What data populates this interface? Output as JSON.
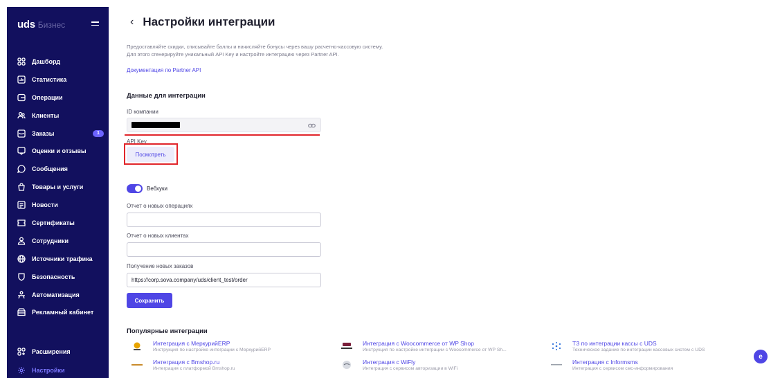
{
  "sidebar": {
    "logo": "uds",
    "logo_sub": "Бизнес",
    "items": [
      {
        "label": "Дашборд",
        "icon": "dashboard-icon"
      },
      {
        "label": "Статистика",
        "icon": "chart-icon"
      },
      {
        "label": "Операции",
        "icon": "operations-icon"
      },
      {
        "label": "Клиенты",
        "icon": "clients-icon"
      },
      {
        "label": "Заказы",
        "icon": "orders-icon",
        "badge": "1"
      },
      {
        "label": "Оценки и отзывы",
        "icon": "reviews-icon"
      },
      {
        "label": "Сообщения",
        "icon": "messages-icon"
      },
      {
        "label": "Товары и услуги",
        "icon": "goods-icon"
      },
      {
        "label": "Новости",
        "icon": "news-icon"
      },
      {
        "label": "Сертификаты",
        "icon": "certificates-icon"
      },
      {
        "label": "Сотрудники",
        "icon": "staff-icon"
      },
      {
        "label": "Источники трафика",
        "icon": "globe-icon"
      },
      {
        "label": "Безопасность",
        "icon": "shield-icon"
      },
      {
        "label": "Автоматизация",
        "icon": "automation-icon"
      },
      {
        "label": "Рекламный кабинет",
        "icon": "ads-icon"
      }
    ],
    "bottom": [
      {
        "label": "Расширения",
        "icon": "extensions-icon"
      },
      {
        "label": "Настройки",
        "icon": "gear-icon",
        "active": true
      }
    ]
  },
  "header": {
    "back": "‹",
    "title": "Настройки интеграции"
  },
  "intro": {
    "line1": "Предоставляйте скидки, списывайте баллы и начисляйте бонусы через вашу расчетно-кассовую систему.",
    "line2": "Для этого сгенерируйте уникальный API Key и настройте интеграцию через Partner API.",
    "doc_link": "Документация по Partner API"
  },
  "integration_data": {
    "heading": "Данные для интеграции",
    "company_id_label": "ID компании",
    "api_key_label": "API Key",
    "view_button": "Посмотреть"
  },
  "webhooks": {
    "toggle_label": "Вебхуки",
    "toggle_on": true,
    "new_operations_label": "Отчет о новых операциях",
    "new_operations_value": "",
    "new_clients_label": "Отчет о новых клиентах",
    "new_clients_value": "",
    "new_orders_label": "Получение новых заказов",
    "new_orders_value": "https://corp.sova.company/uds/client_test/order",
    "save_button": "Сохранить"
  },
  "popular": {
    "heading": "Популярные интеграции",
    "items": [
      {
        "title": "Интеграция с МеркурийERP",
        "subtitle": "Инструкция по настройке интеграции с МеркурийERP",
        "icon": "merkuriy-logo"
      },
      {
        "title": "Интеграция с Woocommerce от WP Shop",
        "subtitle": "Инструкция по настройке интеграции с Woocommerce от WP Sh...",
        "icon": "woocommerce-logo"
      },
      {
        "title": "ТЗ по интеграции кассы с UDS",
        "subtitle": "Техническое задание по интеграции кассовых систем с UDS",
        "icon": "uds-star-logo"
      },
      {
        "title": "Интеграция с Bmshop.ru",
        "subtitle": "Интеграция с платформой Bmshop.ru",
        "icon": "bmshop-logo"
      },
      {
        "title": "Интеграция с WiFly",
        "subtitle": "Интеграция с сервисом авторизации в WiFi",
        "icon": "wifly-logo"
      },
      {
        "title": "Интеграция с Informsms",
        "subtitle": "Интеграция с сервисом смс-информирования",
        "icon": "informsms-logo"
      }
    ]
  },
  "chat_button": "e",
  "colors": {
    "sidebar_bg": "#12105e",
    "accent": "#4f46e5",
    "highlight_red": "#e1252b"
  }
}
